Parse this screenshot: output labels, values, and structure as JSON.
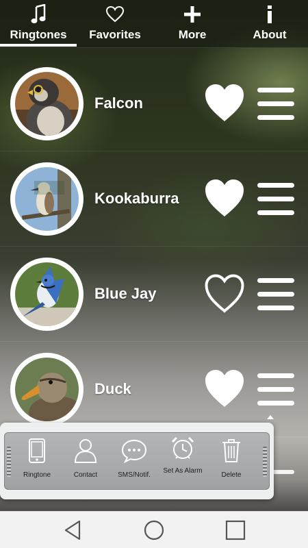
{
  "tabs": [
    {
      "label": "Ringtones",
      "icon": "music-note-icon",
      "active": true
    },
    {
      "label": "Favorites",
      "icon": "heart-outline-icon",
      "active": false
    },
    {
      "label": "More",
      "icon": "plus-icon",
      "active": false
    },
    {
      "label": "About",
      "icon": "info-icon",
      "active": false
    }
  ],
  "ringtones": [
    {
      "name": "Falcon",
      "favorite": true
    },
    {
      "name": "Kookaburra",
      "favorite": true
    },
    {
      "name": "Blue Jay",
      "favorite": false
    },
    {
      "name": "Duck",
      "favorite": true
    }
  ],
  "actions": [
    {
      "label": "Ringtone",
      "icon": "phone-icon"
    },
    {
      "label": "Contact",
      "icon": "contact-icon"
    },
    {
      "label": "SMS/Notif.",
      "icon": "chat-bubble-icon"
    },
    {
      "label": "Set As Alarm",
      "icon": "alarm-clock-icon"
    },
    {
      "label": "Delete",
      "icon": "trash-icon"
    }
  ],
  "navbar": [
    "back-icon",
    "home-icon",
    "recents-icon"
  ],
  "colors": {
    "accent": "#ffffff",
    "popup_bg": "#eef0ef"
  }
}
